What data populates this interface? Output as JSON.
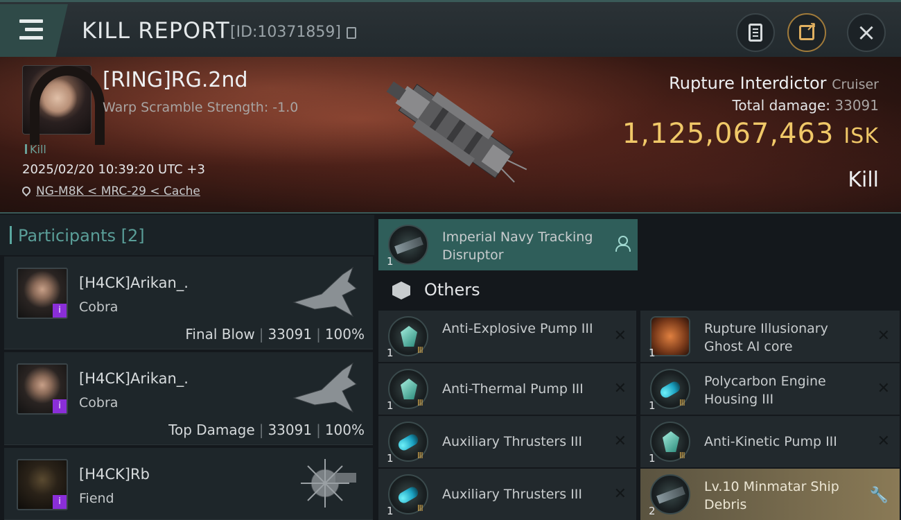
{
  "header": {
    "title": "KILL REPORT",
    "report_id": "[ID:10371859]"
  },
  "victim": {
    "name": "[RING]RG.2nd",
    "warp_scramble": "Warp Scramble Strength: -1.0",
    "tag": "Kill",
    "timestamp": "2025/02/20 10:39:20 UTC +3",
    "location": "NG-M8K < MRC-29 < Cache",
    "ship_name": "Rupture Interdictor",
    "ship_class": "Cruiser",
    "total_damage_label": "Total damage:",
    "total_damage": "33091",
    "isk_value": "1,125,067,463",
    "isk_unit": "ISK",
    "result": "Kill"
  },
  "participants": {
    "title": "Participants [2]",
    "items": [
      {
        "name": "[H4CK]Arikan_.",
        "ship": "Cobra",
        "label": "Final Blow",
        "damage": "33091",
        "percent": "100%"
      },
      {
        "name": "[H4CK]Arikan_.",
        "ship": "Cobra",
        "label": "Top Damage",
        "damage": "33091",
        "percent": "100%"
      },
      {
        "name": "[H4CK]Rb",
        "ship": "Fiend"
      }
    ]
  },
  "modules": {
    "top": {
      "name": "Imperial Navy Tracking Disruptor",
      "qty": "1"
    },
    "others_label": "Others",
    "left": [
      {
        "name": "Anti-Explosive Pump III",
        "qty": "1",
        "tier": "III"
      },
      {
        "name": "Anti-Thermal Pump III",
        "qty": "1",
        "tier": "III"
      },
      {
        "name": "Auxiliary Thrusters III",
        "qty": "1",
        "tier": "III"
      },
      {
        "name": "Auxiliary Thrusters III",
        "qty": "1",
        "tier": "III"
      }
    ],
    "right": [
      {
        "name": "Rupture Illusionary Ghost AI core",
        "qty": "1"
      },
      {
        "name": "Polycarbon Engine Housing III",
        "qty": "1",
        "tier": "III"
      },
      {
        "name": "Anti-Kinetic Pump III",
        "qty": "1",
        "tier": "III"
      },
      {
        "name": "Lv.10 Minmatar Ship Debris",
        "qty": "2"
      }
    ]
  },
  "colors": {
    "accent": "#5a9e98",
    "isk": "#f0c868",
    "badge": "#8a2ed8",
    "highlight": "#2f5e5a"
  }
}
